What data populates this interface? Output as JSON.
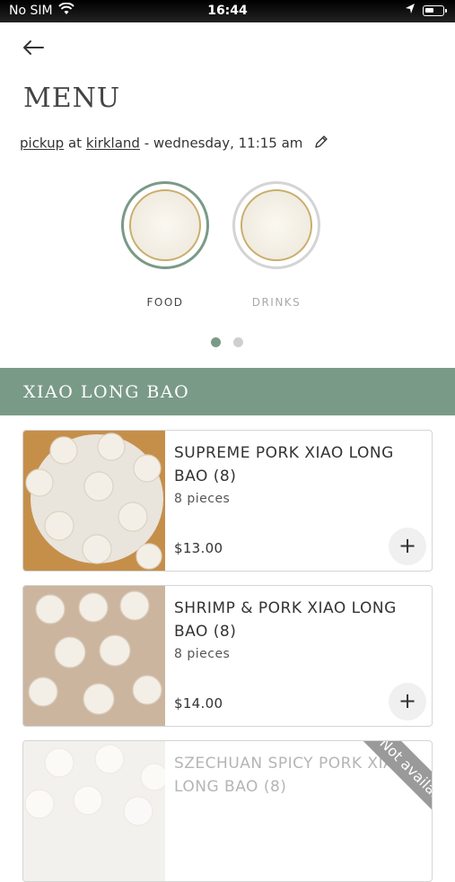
{
  "status_bar": {
    "carrier": "No SIM",
    "time": "16:44"
  },
  "page": {
    "title": "MENU"
  },
  "pickup": {
    "mode": "pickup",
    "at": "at",
    "location": "kirkland",
    "when": "- wednesday, 11:15 am"
  },
  "categories": [
    {
      "label": "FOOD",
      "active": true
    },
    {
      "label": "DRINKS",
      "active": false
    }
  ],
  "pagination": {
    "pages": 2,
    "current": 1
  },
  "section": {
    "title": "XIAO LONG BAO"
  },
  "items": [
    {
      "name": "SUPREME PORK XIAO LONG BAO (8)",
      "description": "8 pieces",
      "price": "$13.00",
      "available": true
    },
    {
      "name": "SHRIMP & PORK XIAO LONG BAO (8)",
      "description": "8 pieces",
      "price": "$14.00",
      "available": true
    },
    {
      "name": "SZECHUAN SPICY PORK XIAO LONG BAO (8)",
      "description": "",
      "price": "",
      "available": false,
      "badge": "Not available"
    }
  ],
  "add_symbol": "+",
  "colors": {
    "accent": "#7a9a88",
    "inactive_ring": "#d4d4d4"
  }
}
